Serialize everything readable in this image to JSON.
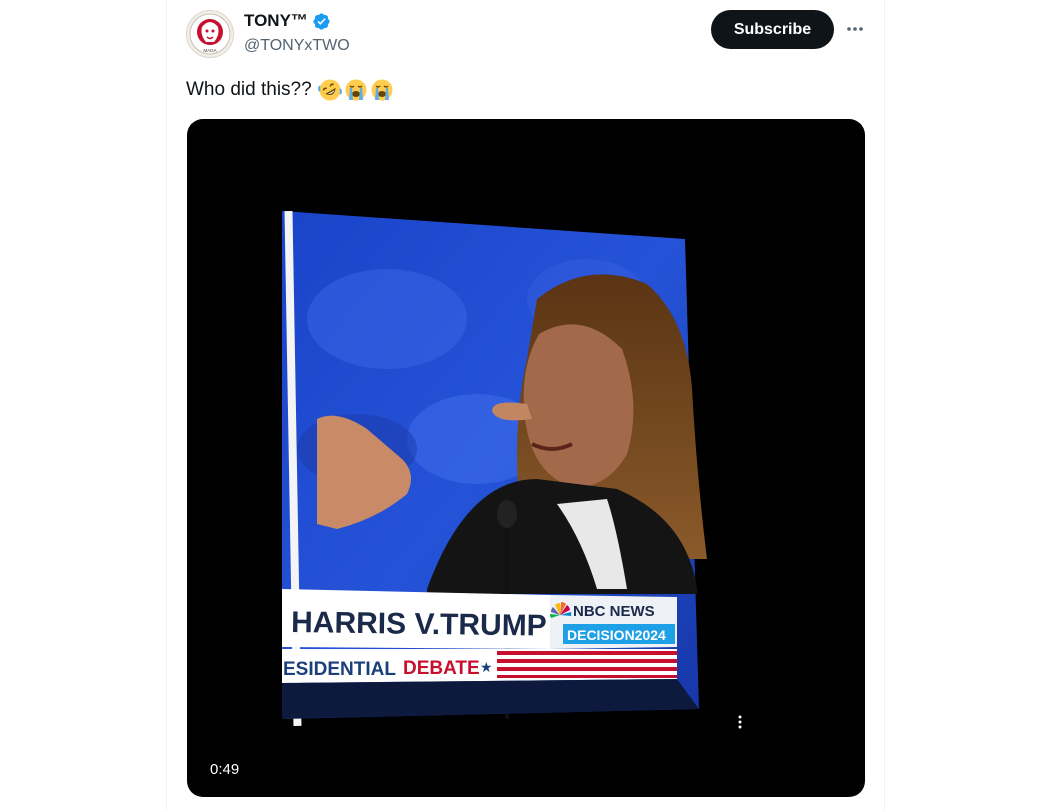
{
  "post": {
    "author": {
      "display_name": "TONY™",
      "handle": "@TONYxTWO",
      "verified": true,
      "avatar_icon": "lion-maga-logo-icon",
      "avatar_caption": "MAGA"
    },
    "subscribe_label": "Subscribe",
    "more_icon": "more-options-icon",
    "text": "Who did this??",
    "emojis": [
      "rolling-on-floor-laughing",
      "loudly-crying",
      "loudly-crying"
    ],
    "video": {
      "duration": "0:49",
      "options_icon": "vertical-dots-icon",
      "screen": {
        "lower_third_title": "HARRIS V.TRUMP",
        "network": "NBC NEWS",
        "program": "DECISION2024",
        "subtitle_prefix": "ESIDENTIAL",
        "subtitle_highlight": "DEBATE",
        "star": "★"
      }
    }
  },
  "colors": {
    "accent_black": "#0f1419",
    "secondary_text": "#536471",
    "verified_blue": "#1d9bf0",
    "debate_red": "#c8102e",
    "lower_third_blue": "#1b3f7a"
  }
}
